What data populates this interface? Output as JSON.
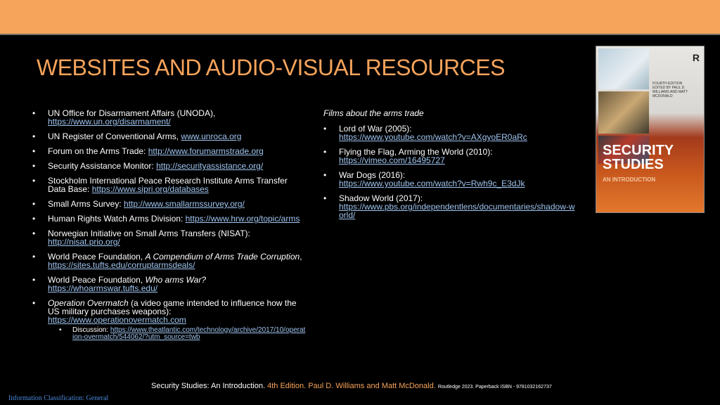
{
  "title": "WEBSITES AND AUDIO-VISUAL RESOURCES",
  "left_items": [
    {
      "text": "UN Office for Disarmament Affairs (UNODA),",
      "link": "https://www.un.org/disarmament/"
    },
    {
      "text": "UN Register of Conventional Arms,",
      "link": "www.unroca.org"
    },
    {
      "text": "Forum on the Arms Trade:",
      "link": "http://www.forumarmstrade.org"
    },
    {
      "text": "Security Assistance Monitor:",
      "link": "http://securityassistance.org/"
    },
    {
      "text": "Stockholm International Peace Research Institute Arms Transfer Data Base:",
      "link": "https://www.sipri.org/databases"
    },
    {
      "text": "Small Arms Survey:",
      "link": "http://www.smallarmssurvey.org/"
    },
    {
      "text": "Human Rights Watch Arms Division:",
      "link": "https://www.hrw.org/topic/arms"
    },
    {
      "text": "Norwegian Initiative on Small Arms Transfers (NISAT):",
      "link": "http://nisat.prio.org/"
    },
    {
      "text_a": "World Peace Foundation,",
      "italic": "A Compendium of Arms Trade Corruption",
      "text_b": ",",
      "link": "https://sites.tufts.edu/corruptarmsdeals/"
    },
    {
      "text_a": "World Peace Foundation,",
      "italic": "Who arms War?",
      "link": "https://whoarmswar.tufts.edu/"
    },
    {
      "italic": "Operation Overmatch",
      "text": "(a video game intended to influence how the US military purchases weapons):",
      "link": "https://www.operationovermatch.com",
      "sub": {
        "label": "Discussion:",
        "link": "https://www.theatlantic.com/technology/archive/2017/10/operation-overmatch/544062/?utm_source=twb"
      }
    }
  ],
  "right_heading": "Films about the arms trade",
  "right_items": [
    {
      "text": "Lord of War (2005):",
      "link": "https://www.youtube.com/watch?v=AXgyoER0aRc"
    },
    {
      "text": "Flying the Flag, Arming the World (2010):",
      "link": "https://vimeo.com/16495727"
    },
    {
      "text": "War Dogs (2016):",
      "link": "https://www.youtube.com/watch?v=Rwh9c_E3dJk"
    },
    {
      "text": "Shadow World (2017):",
      "link": "https://www.pbs.org/independentlens/documentaries/shadow-world/"
    }
  ],
  "book": {
    "title": "SECURITY STUDIES",
    "subtitle": "AN INTRODUCTION",
    "edition": "FOURTH EDITION",
    "editors": "EDITED BY PAUL D. WILLIAMS AND MATT MCDONALD",
    "publisher_logo": "R"
  },
  "footer": {
    "book_title": "Security Studies: An Introduction.",
    "edition": "4th Edition.",
    "authors": "Paul D. Williams and Matt McDonald.",
    "publisher": "Routledge 2023. Paperback ISBN - 9781032162737"
  },
  "classification": "Information Classification: General",
  "colors": {
    "accent": "#f6a35b",
    "link": "#9fc5f0",
    "background": "#000000"
  }
}
